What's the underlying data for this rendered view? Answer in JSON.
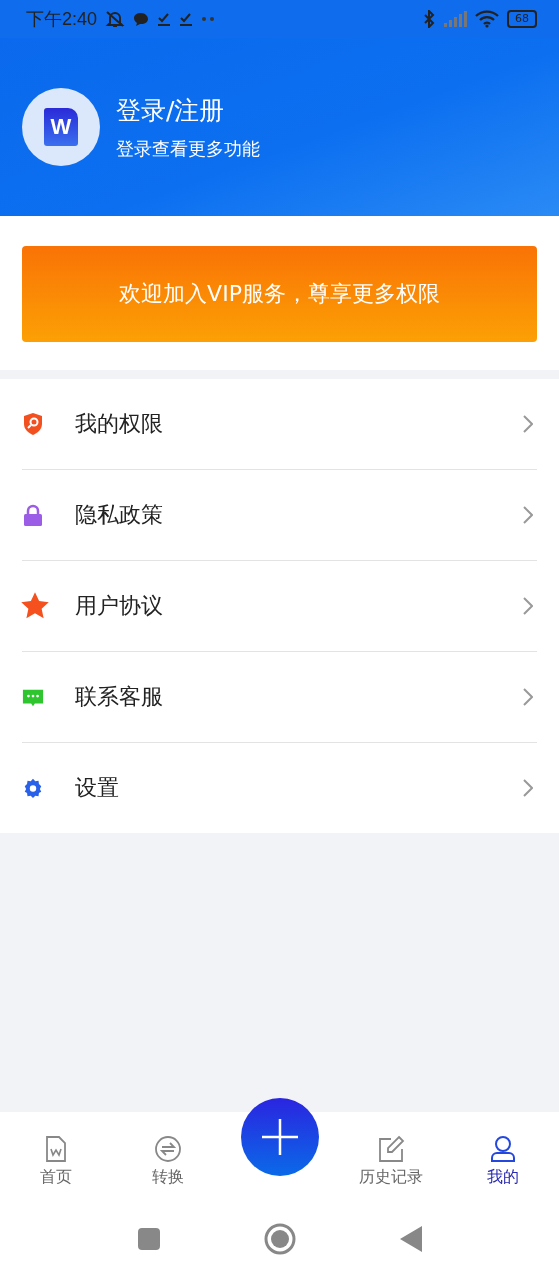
{
  "status_bar": {
    "time": "下午2:40",
    "battery": "68"
  },
  "profile": {
    "logo_letter": "W",
    "title": "登录/注册",
    "subtitle": "登录查看更多功能"
  },
  "vip_banner": "欢迎加入VIP服务，尊享更多权限",
  "menu": [
    {
      "kind": "shield",
      "label": "我的权限"
    },
    {
      "kind": "lock",
      "label": "隐私政策"
    },
    {
      "kind": "star",
      "label": "用户协议"
    },
    {
      "kind": "chat",
      "label": "联系客服"
    },
    {
      "kind": "gear",
      "label": "设置"
    }
  ],
  "tabs": [
    {
      "kind": "doc",
      "label": "首页",
      "selected": false
    },
    {
      "kind": "convert",
      "label": "转换",
      "selected": false
    },
    {
      "kind": "add",
      "selected": false
    },
    {
      "kind": "edit",
      "label": "历史记录",
      "selected": false
    },
    {
      "kind": "user",
      "label": "我的",
      "selected": true
    }
  ]
}
